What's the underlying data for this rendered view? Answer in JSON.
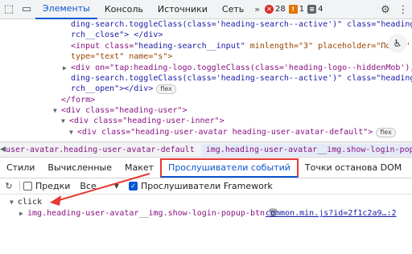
{
  "topbar": {
    "tabs": [
      "Элементы",
      "Консоль",
      "Источники",
      "Сеть"
    ],
    "active_tab": "Элементы",
    "errors": "28",
    "warnings": "1",
    "info": "4"
  },
  "code_lines": {
    "l1": "ding-search.toggleClass(class='heading-search--active')\" class=\"heading-searc",
    "l2": "rch__close\"> </div>",
    "l3_tag": "<input class=",
    "l3_cls": "\"heading-search__input\"",
    "l3_rest": " minlength=\"3\" placeholder=\"Поиск\"",
    "l4": "type=\"text\" name=\"s\">",
    "l5": "<div on=\"tap:heading-logo.toggleClass(class='heading-logo--hiddenMob'), hea",
    "l6": "ding-search.toggleClass(class='heading-search--active')\" class=\"heading-searc",
    "l7": "rch__open\"></div>",
    "l8": "</form>",
    "l9": "<div class=\"heading-user\">",
    "l10": "<div class=\"heading-user-inner\">",
    "l11": "<div class=\"heading-user-avatar heading-user-avatar-default\">",
    "flex_badge": "flex"
  },
  "breadcrumbs": {
    "item1": "user-avatar.heading-user-avatar-default",
    "item2": "img.heading-user-avatar__img.show-login-popup-btn"
  },
  "subtabs": {
    "t1": "Стили",
    "t2": "Вычисленные",
    "t3": "Макет",
    "t4": "Прослушиватели событий",
    "t5": "Точки останова DOM"
  },
  "toolbar": {
    "ancestors_label": "Предки",
    "filter_value": "Все",
    "framework_label": "Прослушиватели Framework"
  },
  "listeners": {
    "event": "click",
    "selector": "img.heading-user-avatar__img.show-login-popup-btn",
    "source": "common.min.js?id=2f1c2a9…:2"
  },
  "colors": {
    "accent": "#0b57d0",
    "annotation": "#e53935"
  }
}
